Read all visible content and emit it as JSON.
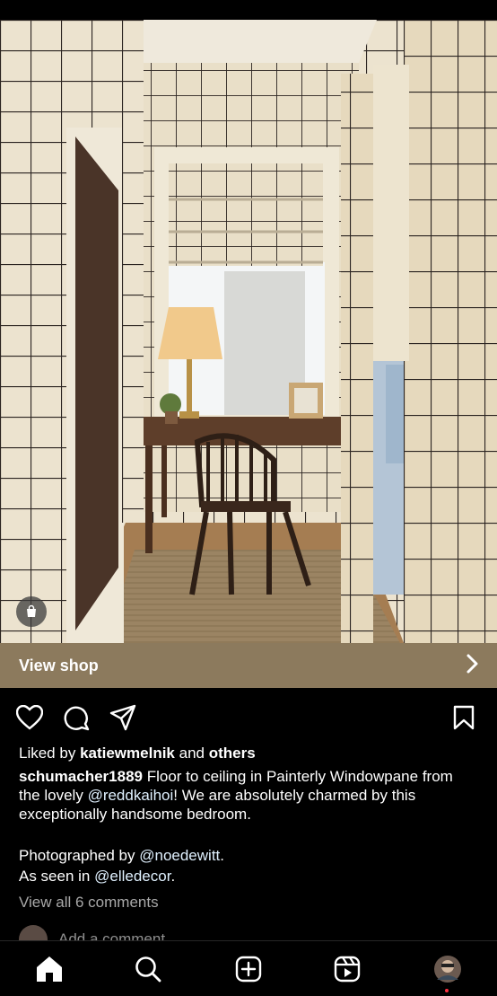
{
  "shop": {
    "label": "View shop"
  },
  "post": {
    "liked_by_prefix": "Liked by",
    "liked_by_user": "katiewmelnik",
    "liked_by_and": "and",
    "liked_by_others": "others",
    "author": "schumacher1889",
    "caption_part1": "Floor to ceiling in Painterly Windowpane from the lovely",
    "mention1": "@reddkaihoi",
    "caption_part2": "! We are absolutely charmed by this exceptionally handsome bedroom.",
    "photographed_prefix": "Photographed by",
    "mention2": "@noedewitt",
    "photographed_suffix": ".",
    "seen_prefix": "As seen in",
    "mention3": "@elledecor",
    "seen_suffix": ".",
    "view_comments": "View all 6 comments",
    "add_comment_placeholder": "Add a comment..."
  },
  "icons": {
    "like": "heart-icon",
    "comment": "comment-icon",
    "share": "send-icon",
    "save": "bookmark-icon",
    "shop": "shopping-bag-icon",
    "chevron": "chevron-right-icon"
  },
  "nav": [
    "home",
    "search",
    "create",
    "reels",
    "profile"
  ],
  "colors": {
    "background": "#000000",
    "shopbar": "#8c7a5d",
    "mention": "#e0f1ff",
    "notification": "#ff3040"
  }
}
